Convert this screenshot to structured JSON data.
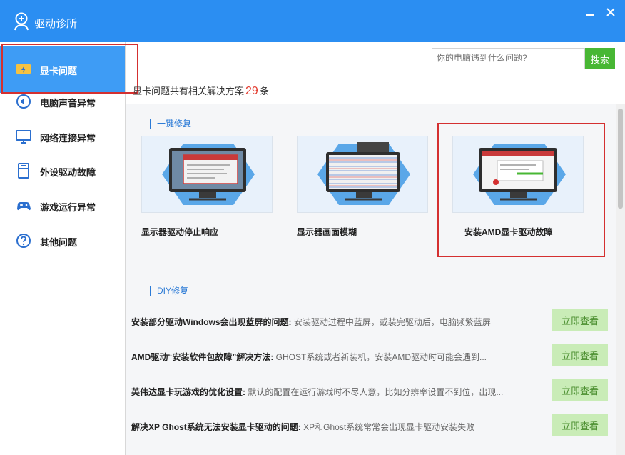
{
  "window": {
    "title": "驱动诊所"
  },
  "sidebar": {
    "items": [
      {
        "label": "显卡问题"
      },
      {
        "label": "电脑声音异常"
      },
      {
        "label": "网络连接异常"
      },
      {
        "label": "外设驱动故障"
      },
      {
        "label": "游戏运行异常"
      },
      {
        "label": "其他问题"
      }
    ]
  },
  "search": {
    "placeholder": "你的电脑遇到什么问题?",
    "button": "搜索"
  },
  "summary": {
    "prefix": "显卡问题共有相关解决方案",
    "count": "29",
    "suffix": "条"
  },
  "one_click": {
    "title": "一键修复",
    "cards": [
      {
        "caption": "显示器驱动停止响应"
      },
      {
        "caption": "显示器画面模糊"
      },
      {
        "caption": "安装AMD显卡驱动故障"
      }
    ]
  },
  "diy": {
    "title": "DIY修复",
    "view_label": "立即查看",
    "items": [
      {
        "title": "安装部分驱动Windows会出现蓝屏的问题:",
        "desc": "安装驱动过程中蓝屏，或装完驱动后，电脑频繁蓝屏"
      },
      {
        "title": "AMD驱动“安装软件包故障”解决方法:",
        "desc": "GHOST系统或者新装机，安装AMD驱动时可能会遇到..."
      },
      {
        "title": "英伟达显卡玩游戏的优化设置:",
        "desc": "默认的配置在运行游戏时不尽人意，比如分辨率设置不到位，出现..."
      },
      {
        "title": "解决XP Ghost系统无法安装显卡驱动的问题:",
        "desc": "XP和Ghost系统常常会出现显卡驱动安装失败"
      }
    ]
  },
  "colors": {
    "accent": "#2b8ef2",
    "active": "#3e9cf5",
    "search_button": "#48b734",
    "highlight": "#d43030",
    "count": "#e33b2e"
  }
}
